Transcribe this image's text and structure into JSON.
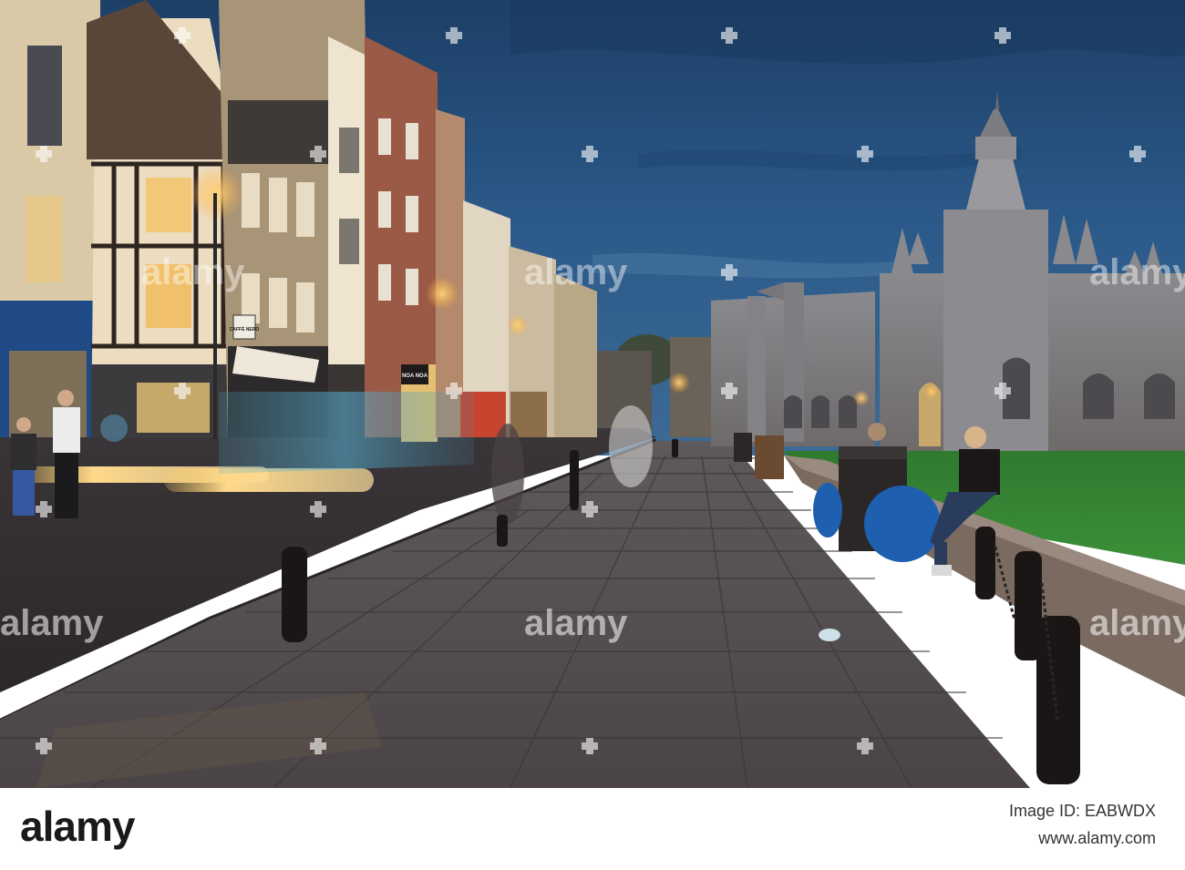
{
  "photo": {
    "scene": "dusk street with college gatehouse",
    "sky_color": "#27507e",
    "shop_signs": [
      "CAFFÈ NERO",
      "NOA NOA"
    ]
  },
  "watermark": {
    "text": "alamy",
    "color": "#ffffff"
  },
  "footer": {
    "logo": "alamy",
    "image_id": "Image ID: EABWDX",
    "site": "www.alamy.com"
  }
}
